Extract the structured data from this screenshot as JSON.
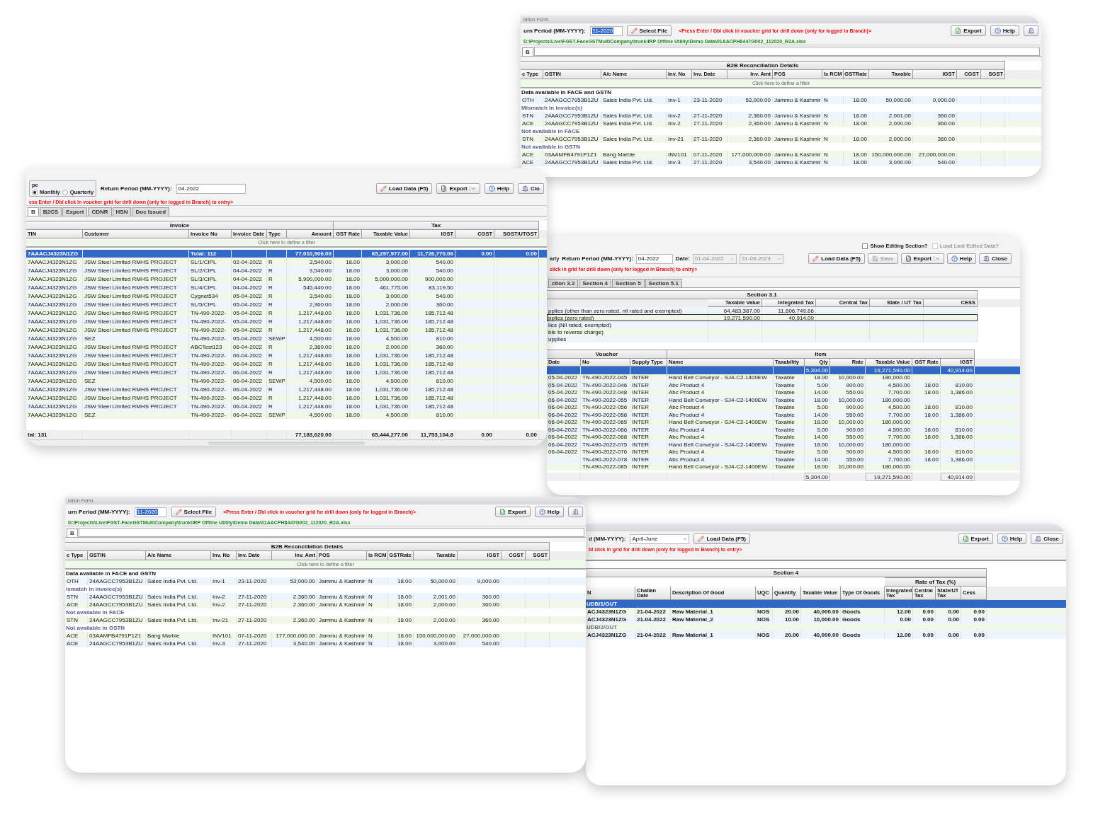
{
  "reconciliation_window_top": {
    "title": "iation Form.",
    "period_label": "urn Period (MM-YYYY):",
    "period_value": "11-2020",
    "select_button": "Select File",
    "note": "<Press Enter / Dbl click in voucher grid for drill down (only for logged in Branch)>",
    "buttons": [
      "Export",
      "Help"
    ],
    "path": "D:\\Projects\\Live\\FGST-FaceGSTMultiCompany\\trunk\\IRP Offline Utility\\Demo Data\\01AACPH8447G002_112020_R2A.xlsx",
    "tab": "B",
    "table_title": "B2B Reconciliation Details",
    "columns": [
      "c Type",
      "GSTIN",
      "A/c Name",
      "Inv. No",
      "Inv. Date",
      "Inv. Amt",
      "POS",
      "Is RCM",
      "GSTRate",
      "Taxable",
      "IGST",
      "CGST",
      "SGST"
    ],
    "filter": "Click here to define a filter",
    "rows": [
      {
        "kind": "group",
        "cells": [
          "Data available in FACE and GSTN"
        ]
      },
      {
        "kind": "data",
        "cells": [
          "OTH",
          "24AAGCC7953B1ZU",
          "Sales India Pvt. Ltd.",
          "Inv-1",
          "23-11-2020",
          "53,000.00",
          "Jammu & Kashmir",
          "N",
          "18.00",
          "50,000.00",
          "9,000.00"
        ]
      },
      {
        "kind": "group",
        "cells": [
          "Mismatch in invoice(s)"
        ]
      },
      {
        "kind": "data",
        "cells": [
          "STN",
          "24AAGCC7953B1ZU",
          "Sales India Pvt. Ltd.",
          "Inv-2",
          "27-11-2020",
          "2,360.00",
          "Jammu & Kashmir",
          "N",
          "18.00",
          "2,001.00",
          "360.00"
        ]
      },
      {
        "kind": "data",
        "cells": [
          "ACE",
          "24AAGCC7953B1ZU",
          "Sales India Pvt. Ltd.",
          "Inv-2",
          "27-11-2020",
          "2,360.00",
          "Jammu & Kashmir",
          "N",
          "18.00",
          "2,000.00",
          "360.00"
        ]
      },
      {
        "kind": "group",
        "cells": [
          "Not available in FACE"
        ]
      },
      {
        "kind": "data",
        "cells": [
          "STN",
          "24AAGCC7953B1ZU",
          "Sales India Pvt. Ltd.",
          "Inv-21",
          "27-11-2020",
          "2,360.00",
          "Jammu & Kashmir",
          "N",
          "18.00",
          "2,000.00",
          "360.00"
        ]
      },
      {
        "kind": "group",
        "cells": [
          "Not available in GSTN"
        ]
      },
      {
        "kind": "data",
        "cells": [
          "ACE",
          "03AAMFB4791P1Z1",
          "Bang Marble",
          "INV101",
          "07-11-2020",
          "177,000,000.00",
          "Jammu & Kashmir",
          "N",
          "18.00",
          "150,000,000.00",
          "27,000,000.00"
        ]
      },
      {
        "kind": "data",
        "cells": [
          "ACE",
          "24AAGCC7953B1ZU",
          "Sales India Pvt. Ltd.",
          "Inv-3",
          "27-11-2020",
          "3,540.00",
          "Jammu & Kashmir",
          "N",
          "18.00",
          "3,000.00",
          "540.00"
        ]
      }
    ]
  },
  "gstr1_window": {
    "type_label": "pe",
    "periodicity": [
      {
        "label": "Monthly",
        "selected": true
      },
      {
        "label": "Quarterly",
        "selected": false
      }
    ],
    "period_label": "Return Period (MM-YYYY):",
    "period_value": "04-2022",
    "buttons": [
      {
        "label": "Load Data (F5)",
        "dropdown": false
      },
      {
        "label": "Export",
        "dropdown": true
      },
      {
        "label": "Help",
        "dropdown": false
      },
      {
        "label": "Clo",
        "dropdown": false
      }
    ],
    "note": "ess Enter / Dbl click in voucher grid for drill down (only for logged in Branch) to entry>",
    "tabs": [
      {
        "label": "B",
        "selected": true
      },
      {
        "label": "B2CS",
        "selected": false
      },
      {
        "label": "Export",
        "selected": false
      },
      {
        "label": "CDNR",
        "selected": false
      },
      {
        "label": "HSN",
        "selected": false
      },
      {
        "label": "Doc Issued",
        "selected": false
      }
    ],
    "bands": [
      "Invoice",
      "Tax"
    ],
    "columns": [
      "TIN",
      "Customer",
      "Invoice No",
      "Invoice Date",
      "Type",
      "Amount",
      "GST Rate",
      "Taxable Value",
      "IGST",
      "CGST",
      "SGST/UTGST"
    ],
    "filter": "Click here to define a filter",
    "total_row": {
      "selected": true,
      "gstin": "7AAACJ4323N1ZG",
      "label": "Total: 112",
      "amount": "77,010,906.00",
      "taxable_value": "65,297,977.00",
      "igst": "11,726,770.06",
      "cgst": "0.00",
      "sgst": "0.00"
    },
    "rows": [
      {
        "selected": false,
        "cells": [
          "7AAACJ4323N1ZG",
          "JSW Steel Limited RMHS PROJECT",
          "SL/1/CIPL",
          "02-04-2022",
          "R",
          "3,540.00",
          "18.00",
          "3,000.00",
          "540.00"
        ]
      },
      {
        "selected": false,
        "cells": [
          "7AAACJ4323N1ZG",
          "JSW Steel Limited RMHS PROJECT",
          "SL/2/CIPL",
          "04-04-2022",
          "R",
          "3,540.00",
          "18.00",
          "3,000.00",
          "540.00"
        ]
      },
      {
        "selected": false,
        "cells": [
          "7AAACJ4323N1ZG",
          "JSW Steel Limited RMHS PROJECT",
          "SL/3/CIPL",
          "04-04-2022",
          "R",
          "5,900,000.00",
          "18.00",
          "5,000,000.00",
          "900,000.00"
        ]
      },
      {
        "selected": false,
        "cells": [
          "7AAACJ4323N1ZG",
          "JSW Steel Limited RMHS PROJECT",
          "SL/4/CIPL",
          "04-04-2022",
          "R",
          "545,440.00",
          "18.00",
          "461,775.00",
          "83,119.50"
        ]
      },
      {
        "selected": false,
        "cells": [
          "7AAACJ4323N1ZG",
          "JSW Steel Limited RMHS PROJECT",
          "Cygnet534",
          "05-04-2022",
          "R",
          "3,540.00",
          "18.00",
          "3,000.00",
          "540.00"
        ]
      },
      {
        "selected": false,
        "cells": [
          "7AAACJ4323N1ZG",
          "JSW Steel Limited RMHS PROJECT",
          "SL/5/CIPL",
          "05-04-2022",
          "R",
          "2,360.00",
          "18.00",
          "2,000.00",
          "360.00"
        ]
      },
      {
        "selected": false,
        "cells": [
          "7AAACJ4323N1ZG",
          "JSW Steel Limited RMHS PROJECT",
          "TN-490-2022-",
          "05-04-2022",
          "R",
          "1,217,448.00",
          "18.00",
          "1,031,736.00",
          "185,712.48"
        ]
      },
      {
        "selected": false,
        "cells": [
          "7AAACJ4323N1ZG",
          "JSW Steel Limited RMHS PROJECT",
          "TN-490-2022-",
          "05-04-2022",
          "R",
          "1,217,448.00",
          "18.00",
          "1,031,736.00",
          "185,712.48"
        ]
      },
      {
        "selected": false,
        "cells": [
          "7AAACJ4323N1ZG",
          "JSW Steel Limited RMHS PROJECT",
          "TN-490-2022-",
          "05-04-2022",
          "R",
          "1,217,448.00",
          "18.00",
          "1,031,736.00",
          "185,712.48"
        ]
      },
      {
        "selected": false,
        "cells": [
          "7AAACJ4323N1ZG",
          "SEZ",
          "TN-490-2022-",
          "05-04-2022",
          "SEWP",
          "4,500.00",
          "18.00",
          "4,500.00",
          "810.00"
        ]
      },
      {
        "selected": false,
        "cells": [
          "7AAACJ4323N1ZG",
          "JSW Steel Limited RMHS PROJECT",
          "ABCTest123",
          "06-04-2022",
          "R",
          "2,360.00",
          "18.00",
          "2,000.00",
          "360.00"
        ]
      },
      {
        "selected": false,
        "cells": [
          "7AAACJ4323N1ZG",
          "JSW Steel Limited RMHS PROJECT",
          "TN-490-2022-",
          "06-04-2022",
          "R",
          "1,217,448.00",
          "18.00",
          "1,031,736.00",
          "185,712.48"
        ]
      },
      {
        "selected": false,
        "cells": [
          "7AAACJ4323N1ZG",
          "JSW Steel Limited RMHS PROJECT",
          "TN-490-2022-",
          "06-04-2022",
          "R",
          "1,217,448.00",
          "18.00",
          "1,031,736.00",
          "185,712.48"
        ]
      },
      {
        "selected": false,
        "cells": [
          "7AAACJ4323N1ZG",
          "JSW Steel Limited RMHS PROJECT",
          "TN-490-2022-",
          "06-04-2022",
          "R",
          "1,217,448.00",
          "18.00",
          "1,031,736.00",
          "185,712.48"
        ]
      },
      {
        "selected": false,
        "cells": [
          "7AAACJ4323N1ZG",
          "SEZ",
          "TN-490-2022-",
          "06-04-2022",
          "SEWP",
          "4,500.00",
          "18.00",
          "4,500.00",
          "810.00"
        ]
      },
      {
        "selected": false,
        "cells": [
          "7AAACJ4323N1ZG",
          "JSW Steel Limited RMHS PROJECT",
          "TN-490-2022-",
          "06-04-2022",
          "R",
          "1,217,448.00",
          "18.00",
          "1,031,736.00",
          "185,712.48"
        ]
      },
      {
        "selected": false,
        "cells": [
          "7AAACJ4323N1ZG",
          "JSW Steel Limited RMHS PROJECT",
          "TN-490-2022-",
          "06-04-2022",
          "R",
          "1,217,448.00",
          "18.00",
          "1,031,736.00",
          "185,712.48"
        ]
      },
      {
        "selected": false,
        "cells": [
          "7AAACJ4323N1ZG",
          "JSW Steel Limited RMHS PROJECT",
          "TN-490-2022-",
          "06-04-2022",
          "R",
          "1,217,448.00",
          "18.00",
          "1,031,736.00",
          "185,712.48"
        ]
      },
      {
        "selected": false,
        "cells": [
          "7AAACJ4323N1ZG",
          "SEZ",
          "TN-490-2022-",
          "06-04-2022",
          "SEWP",
          "4,500.00",
          "18.00",
          "4,500.00",
          "810.00"
        ]
      }
    ],
    "footer": {
      "label": "tal: 131",
      "values": [
        "77,183,620.00",
        "65,444,277.00",
        "11,753,104.8",
        "0.00",
        "0.00"
      ]
    }
  },
  "gstr3b_window": {
    "periodicity_label": "arly",
    "period_label": "Return Period (MM-YYYY):",
    "period_value": "04-2022",
    "date_label": "Date:",
    "date_from": "01-04-2022",
    "date_to": "31-03-2023",
    "options": [
      {
        "label": "Show Editing Section?",
        "checked": false,
        "disabled": false
      },
      {
        "label": "Load Last Edited Data?",
        "checked": false,
        "disabled": true
      }
    ],
    "buttons": [
      {
        "label": "Load Data (F5)",
        "dropdown": false,
        "disabled": false
      },
      {
        "label": "Save",
        "dropdown": false,
        "disabled": true
      },
      {
        "label": "Export",
        "dropdown": true,
        "disabled": false
      },
      {
        "label": "Help",
        "dropdown": false,
        "disabled": false
      },
      {
        "label": "Close",
        "dropdown": false,
        "disabled": false
      }
    ],
    "note": "click in grid for drill down (only for logged in Branch) to entry>",
    "tabs": [
      {
        "label": "ction 3.2",
        "selected": false
      },
      {
        "label": "Section 4",
        "selected": false
      },
      {
        "label": "Section 5",
        "selected": false
      },
      {
        "label": "Section 5.1",
        "selected": false
      }
    ],
    "section_title": "Section 3.1",
    "section_columns": [
      "Taxable Value",
      "Integrated Tax",
      "Central Tax",
      "State / UT Tax",
      "CESS"
    ],
    "section_rows": [
      {
        "selected": false,
        "cells": [
          "pplies (other than zero rated, nil rated and exempted)",
          "64,483,387.00",
          "11,606,749.66"
        ]
      },
      {
        "selected": true,
        "cells": [
          "pplies (zero rated)",
          "19,271,590.00",
          "40,914.00"
        ]
      },
      {
        "selected": false,
        "cells": [
          "lies (Nil rated, exempted)"
        ]
      },
      {
        "selected": false,
        "cells": [
          "ble to reverse charge)"
        ]
      },
      {
        "selected": false,
        "cells": [
          "upplies"
        ]
      }
    ],
    "bands": [
      "Voucher",
      "Item"
    ],
    "columns": [
      "Date",
      "No",
      "Supply Type",
      "Name",
      "Taxability",
      "Qty",
      "Rate",
      "Taxable Value",
      "GST Rate",
      "IGST"
    ],
    "items": [
      {
        "selected": true,
        "qty": "5,304.00",
        "taxable_value": "19,271,590.00",
        "igst": "40,914.00"
      },
      {
        "selected": false,
        "date": "05-04-2022",
        "no": "TN-490-2022-045",
        "supply_type": "INTER",
        "name": "Hand Belt Conveyor - SJ4-C2-1400EW",
        "taxability": "Taxable",
        "qty": "18.00",
        "rate": "10,000.00",
        "taxable_value": "180,000.00"
      },
      {
        "selected": false,
        "date": "05-04-2022",
        "no": "TN-490-2022-046",
        "supply_type": "INTER",
        "name": "Abc Product 4",
        "taxability": "Taxable",
        "qty": "5.00",
        "rate": "900.00",
        "taxable_value": "4,500.00",
        "gst_rate": "18.00",
        "igst": "810.00"
      },
      {
        "selected": false,
        "date": "05-04-2022",
        "no": "TN-490-2022-048",
        "supply_type": "INTER",
        "name": "Abc Product 4",
        "taxability": "Taxable",
        "qty": "14.00",
        "rate": "550.00",
        "taxable_value": "7,700.00",
        "gst_rate": "18.00",
        "igst": "1,386.00"
      },
      {
        "selected": false,
        "date": "06-04-2022",
        "no": "TN-490-2022-055",
        "supply_type": "INTER",
        "name": "Hand Belt Conveyor - SJ4-C2-1400EW",
        "taxability": "Taxable",
        "qty": "18.00",
        "rate": "10,000.00",
        "taxable_value": "180,000.00"
      },
      {
        "selected": false,
        "date": "06-04-2022",
        "no": "TN-490-2022-056",
        "supply_type": "INTER",
        "name": "Abc Product 4",
        "taxability": "Taxable",
        "qty": "5.00",
        "rate": "900.00",
        "taxable_value": "4,500.00",
        "gst_rate": "18.00",
        "igst": "810.00"
      },
      {
        "selected": false,
        "date": "06-04-2022",
        "no": "TN-490-2022-058",
        "supply_type": "INTER",
        "name": "Abc Product 4",
        "taxability": "Taxable",
        "qty": "14.00",
        "rate": "550.00",
        "taxable_value": "7,700.00",
        "gst_rate": "18.00",
        "igst": "1,386.00"
      },
      {
        "selected": false,
        "date": "06-04-2022",
        "no": "TN-490-2022-065",
        "supply_type": "INTER",
        "name": "Hand Belt Conveyor - SJ4-C2-1400EW",
        "taxability": "Taxable",
        "qty": "18.00",
        "rate": "10,000.00",
        "taxable_value": "180,000.00"
      },
      {
        "selected": false,
        "date": "06-04-2022",
        "no": "TN-490-2022-066",
        "supply_type": "INTER",
        "name": "Abc Product 4",
        "taxability": "Taxable",
        "qty": "5.00",
        "rate": "900.00",
        "taxable_value": "4,500.00",
        "gst_rate": "18.00",
        "igst": "810.00"
      },
      {
        "selected": false,
        "date": "06-04-2022",
        "no": "TN-490-2022-068",
        "supply_type": "INTER",
        "name": "Abc Product 4",
        "taxability": "Taxable",
        "qty": "14.00",
        "rate": "550.00",
        "taxable_value": "7,700.00",
        "gst_rate": "18.00",
        "igst": "1,386.00"
      },
      {
        "selected": false,
        "date": "06-04-2022",
        "no": "TN-490-2022-075",
        "supply_type": "INTER",
        "name": "Hand Belt Conveyor - SJ4-C2-1400EW",
        "taxability": "Taxable",
        "qty": "18.00",
        "rate": "10,000.00",
        "taxable_value": "180,000.00"
      },
      {
        "selected": false,
        "date": "06-04-2022",
        "no": "TN-490-2022-076",
        "supply_type": "INTER",
        "name": "Abc Product 4",
        "taxability": "Taxable",
        "qty": "5.00",
        "rate": "900.00",
        "taxable_value": "4,500.00",
        "gst_rate": "18.00",
        "igst": "810.00"
      },
      {
        "selected": false,
        "no": "TN-490-2022-078",
        "supply_type": "INTER",
        "name": "Abc Product 4",
        "taxability": "Taxable",
        "qty": "14.00",
        "rate": "550.00",
        "taxable_value": "7,700.00",
        "gst_rate": "18.00",
        "igst": "1,386.00"
      },
      {
        "selected": false,
        "no": "TN-490-2022-085",
        "supply_type": "INTER",
        "name": "Hand Belt Conveyor - SJ4-C2-1400EW",
        "taxability": "Taxable",
        "qty": "18.00",
        "rate": "10,000.00",
        "taxable_value": "180,000.00"
      }
    ],
    "footer": {
      "qty": "5,304.00",
      "taxable_value": "19,271,590.00",
      "igst": "40,914.00"
    }
  },
  "reconciliation_window_bottom": {
    "title": "iation Form.",
    "period_label": "urn Period (MM-YYYY):",
    "period_value": "11-2020",
    "select_button": "Select File",
    "note": "<Press Enter / Dbl click in voucher grid for drill down (only for logged in Branch)>",
    "buttons": [
      "Export",
      "Help"
    ],
    "path": "D:\\Projects\\Live\\FGST-FaceGSTMultiCompany\\trunk\\IRP Offline Utility\\Demo Data\\01AACPH8447G002_112020_R2A.xlsx",
    "tab": "B",
    "table_title": "B2B Reconciliation Details",
    "columns": [
      "c Type",
      "GSTIN",
      "A/c Name",
      "Inv. No",
      "Inv. Date",
      "Inv. Amt",
      "POS",
      "Is RCM",
      "GSTRate",
      "Taxable",
      "IGST",
      "CGST",
      "SGST"
    ],
    "filter": "Click here to define a filter",
    "rows": [
      {
        "kind": "group",
        "cells": [
          "Data available in FACE and GSTN"
        ]
      },
      {
        "kind": "data",
        "cells": [
          "OTH",
          "24AAGCC7953B1ZU",
          "Sales India Pvt. Ltd.",
          "Inv-1",
          "23-11-2020",
          "53,000.00",
          "Jammu & Kashmir",
          "N",
          "18.00",
          "50,000.00",
          "9,000.00"
        ]
      },
      {
        "kind": "group",
        "cells": [
          "ismatch in invoice(s)"
        ]
      },
      {
        "kind": "data",
        "cells": [
          "STN",
          "24AAGCC7953B1ZU",
          "Sales India Pvt. Ltd.",
          "Inv-2",
          "27-11-2020",
          "2,360.00",
          "Jammu & Kashmir",
          "N",
          "18.00",
          "2,001.00",
          "360.00"
        ]
      },
      {
        "kind": "data",
        "cells": [
          "ACE",
          "24AAGCC7953B1ZU",
          "Sales India Pvt. Ltd.",
          "Inv-2",
          "27-11-2020",
          "2,360.00",
          "Jammu & Kashmir",
          "N",
          "18.00",
          "2,000.00",
          "360.00"
        ]
      },
      {
        "kind": "group",
        "cells": [
          "Not available in FACE"
        ]
      },
      {
        "kind": "data",
        "cells": [
          "STN",
          "24AAGCC7953B1ZU",
          "Sales India Pvt. Ltd.",
          "Inv-21",
          "27-11-2020",
          "2,360.00",
          "Jammu & Kashmir",
          "N",
          "18.00",
          "2,000.00",
          "360.00"
        ]
      },
      {
        "kind": "group",
        "cells": [
          "Not available in GSTN"
        ]
      },
      {
        "kind": "data",
        "cells": [
          "ACE",
          "03AAMFB4791P1Z1",
          "Bang Marble",
          "INV101",
          "07-11-2020",
          "177,000,000.00",
          "Jammu & Kashmir",
          "N",
          "18.00",
          "150,000,000.00",
          "27,000,000.00"
        ]
      },
      {
        "kind": "data",
        "cells": [
          "ACE",
          "24AAGCC7953B1ZU",
          "Sales India Pvt. Ltd.",
          "Inv-3",
          "27-11-2020",
          "3,540.00",
          "Jammu & Kashmir",
          "N",
          "18.00",
          "3,000.00",
          "540.00"
        ]
      }
    ]
  },
  "section4_window": {
    "period_label": "d (MM-YYYY):",
    "period_value": "April-June",
    "load_button": "Load Data (F5)",
    "buttons": [
      "Export",
      "Help",
      "Close"
    ],
    "note": "bl click in grid for drill down (only for logged in Branch) to entry>",
    "table_title": "Section 4",
    "band": "Rate of Tax (%)",
    "columns": [
      "N",
      "Challan Date",
      "Description Of Good",
      "UQC",
      "Quantity",
      "Taxable Value",
      "Type Of Goods",
      "Integrated Tax",
      "Central Tax",
      "State/UT Tax",
      "Cess"
    ],
    "rows": [
      {
        "kind": "group",
        "selected": true,
        "cells": [
          "UDB/1/OUT"
        ]
      },
      {
        "kind": "data",
        "selected": false,
        "cells": [
          "ACJ4323N1ZG",
          "21-04-2022",
          "Raw Material_1",
          "NOS",
          "20.00",
          "40,000.00",
          "Goods",
          "12.00",
          "0.00",
          "0.00",
          "0.00"
        ]
      },
      {
        "kind": "data",
        "selected": false,
        "cells": [
          "ACJ4323N1ZG",
          "21-04-2022",
          "Raw Material_2",
          "NOS",
          "10.00",
          "10,000.00",
          "Goods",
          "0.00",
          "0.00",
          "0.00",
          "0.00"
        ]
      },
      {
        "kind": "group",
        "selected": false,
        "cells": [
          "UDB/2/OUT"
        ]
      },
      {
        "kind": "data",
        "selected": false,
        "cells": [
          "ACJ4323N1ZG",
          "21-04-2022",
          "Raw Material_1",
          "NOS",
          "20.00",
          "40,000.00",
          "Goods",
          "12.00",
          "0.00",
          "0.00",
          "0.00"
        ]
      }
    ]
  }
}
